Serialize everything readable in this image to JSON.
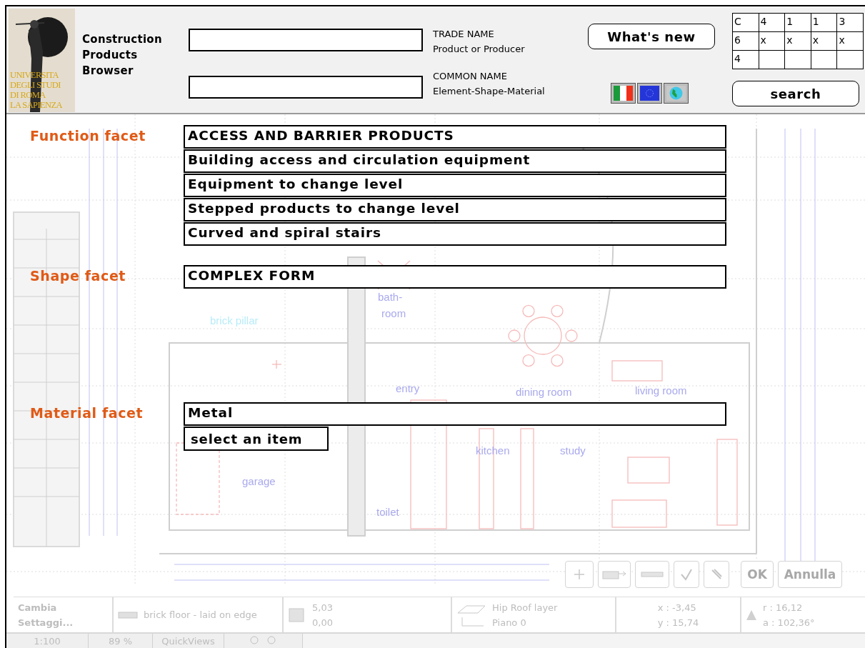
{
  "header": {
    "logo_text": [
      "UNIVERSITA",
      "DEGLI STUDI",
      "DI ROMA",
      "LA SAPIENZA"
    ],
    "title": [
      "Construction",
      "Products",
      "Browser"
    ],
    "fields": [
      {
        "label": "TRADE NAME",
        "hint": "Product or Producer"
      },
      {
        "label": "COMMON NAME",
        "hint": "Element-Shape-Material"
      }
    ],
    "whats_new": "What's new",
    "languages": [
      {
        "kind": "italy"
      },
      {
        "kind": "europe"
      },
      {
        "kind": "world"
      }
    ],
    "code_grid": [
      [
        "C",
        "4",
        "1",
        "1",
        "3"
      ],
      [
        "6",
        "x",
        "x",
        "x",
        "x"
      ],
      [
        "4"
      ]
    ],
    "search": "search"
  },
  "facets": [
    {
      "label": "Function facet",
      "values": [
        "ACCESS AND BARRIER PRODUCTS",
        "Building access and circulation equipment",
        "Equipment to change level",
        "Stepped products to change level",
        "Curved and spiral stairs"
      ]
    },
    {
      "label": "Shape facet",
      "values": [
        "COMPLEX FORM"
      ]
    },
    {
      "label": "Material facet",
      "values": [
        "Metal"
      ],
      "select": "select an item"
    }
  ],
  "cad_background": {
    "rooms": [
      "bath-",
      "room",
      "brick pillar",
      "entry",
      "dining room",
      "living room",
      "kitchen",
      "study",
      "garage",
      "toilet"
    ],
    "dialog_buttons": [
      "OK",
      "Annulla"
    ],
    "info_bar": {
      "settings": "Cambia Settaggi...",
      "material": "brick floor - laid on edge",
      "values": [
        "5,03",
        "0,00"
      ],
      "layer": "Hip Roof layer",
      "story": "Piano 0",
      "coords": [
        "x : -3,45",
        "y : 15,74"
      ],
      "polar": [
        "r : 16,12",
        "a : 102,36°"
      ]
    },
    "view_bar": {
      "scale": "1:100",
      "zoom": "89 %",
      "quickviews": "QuickViews"
    }
  }
}
